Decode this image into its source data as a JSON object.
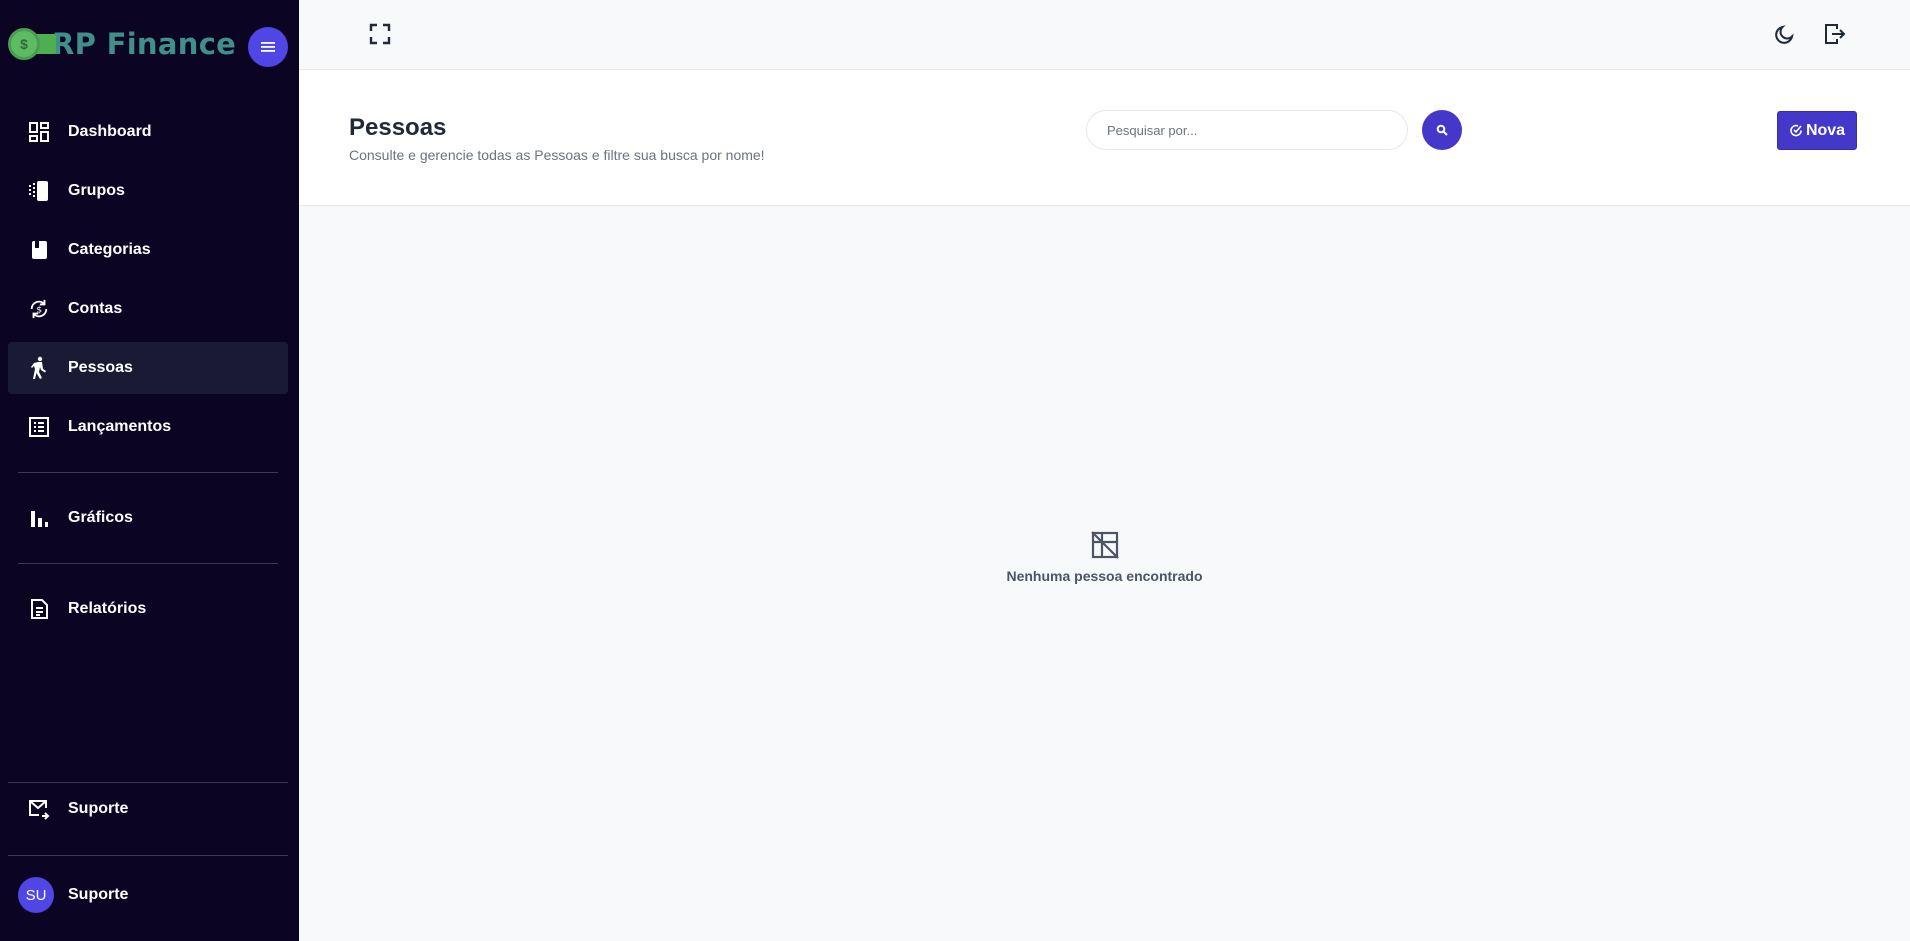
{
  "brand": {
    "name": "RP Finance",
    "coin_symbol": "$"
  },
  "sidebar": {
    "items": [
      {
        "label": "Dashboard",
        "icon": "dashboard-icon"
      },
      {
        "label": "Grupos",
        "icon": "groups-icon"
      },
      {
        "label": "Categorias",
        "icon": "book-icon"
      },
      {
        "label": "Contas",
        "icon": "currency-exchange-icon"
      },
      {
        "label": "Pessoas",
        "icon": "walking-person-icon",
        "active": true
      },
      {
        "label": "Lançamentos",
        "icon": "list-icon"
      },
      {
        "label": "Gráficos",
        "icon": "bar-chart-icon"
      },
      {
        "label": "Relatórios",
        "icon": "document-icon"
      }
    ],
    "support_label": "Suporte",
    "user": {
      "initials": "SU",
      "name": "Suporte"
    }
  },
  "header": {
    "title": "Pessoas",
    "subtitle": "Consulte e gerencie todas as Pessoas e filtre sua busca por nome!",
    "search_placeholder": "Pesquisar por...",
    "search_value": "",
    "new_label": "Nova"
  },
  "empty_state": {
    "message": "Nenhuma pessoa encontrado"
  },
  "colors": {
    "sidebar_bg": "#0c0423",
    "accent": "#4338ca",
    "active_item": "#1a1a35",
    "brand_text": "#3f8f8a"
  }
}
